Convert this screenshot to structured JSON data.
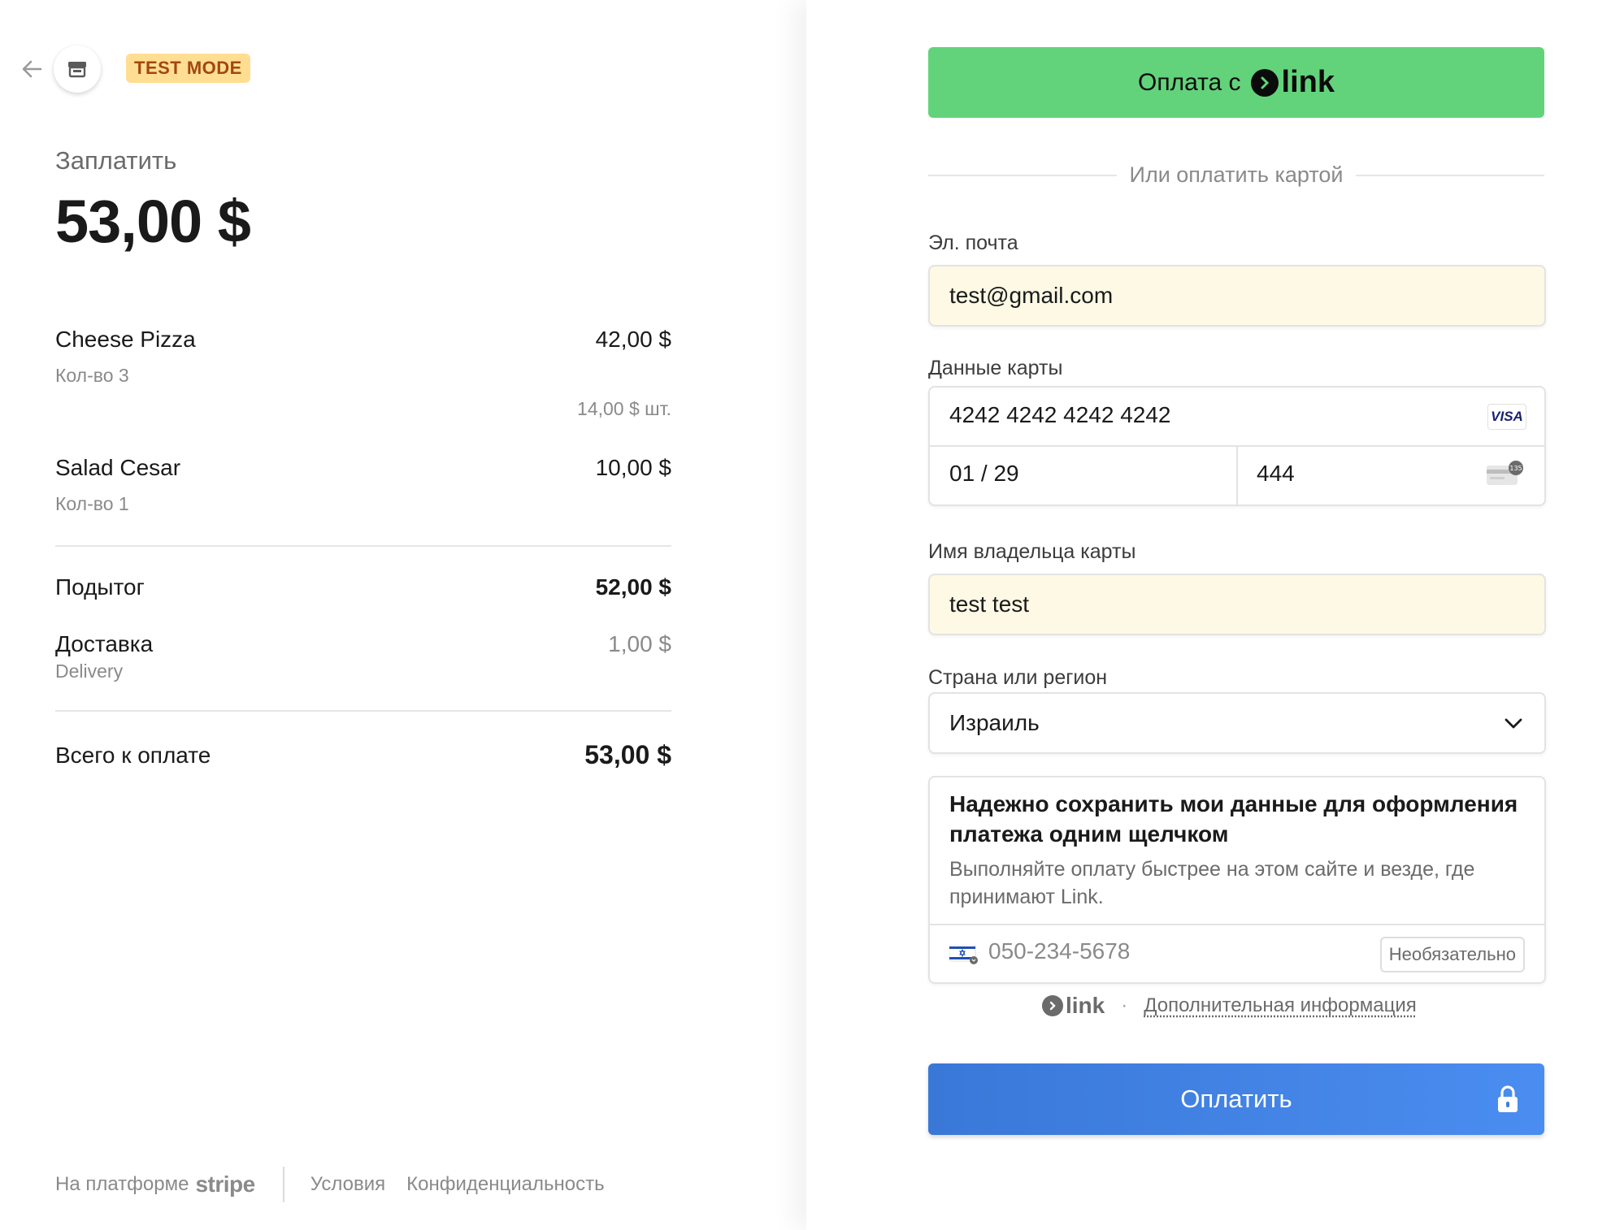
{
  "header": {
    "badge": "TEST MODE"
  },
  "summary": {
    "pay_label": "Заплатить",
    "total": "53,00 $",
    "items": [
      {
        "name": "Cheese Pizza",
        "qty": "Кол-во 3",
        "amount": "42,00 $",
        "unit_price": "14,00 $ шт."
      },
      {
        "name": "Salad Cesar",
        "qty": "Кол-во 1",
        "amount": "10,00 $"
      }
    ],
    "subtotal_label": "Подытог",
    "subtotal": "52,00 $",
    "shipping_label": "Доставка",
    "shipping_method": "Delivery",
    "shipping": "1,00 $",
    "total_label": "Всего к оплате",
    "total_due": "53,00 $"
  },
  "footer": {
    "powered_by": "На платформе",
    "brand": "stripe",
    "terms": "Условия",
    "privacy": "Конфиденциальность"
  },
  "form": {
    "link_button_label": "Оплата с",
    "link_brand": "link",
    "or_card": "Или оплатить картой",
    "email_label": "Эл. почта",
    "email_value": "test@gmail.com",
    "card_label": "Данные карты",
    "card_number": "4242 4242 4242 4242",
    "card_brand": "VISA",
    "expiry": "01 / 29",
    "cvc": "444",
    "cvc_icon_text": "135",
    "name_label": "Имя владельца карты",
    "name_value": "test test",
    "country_label": "Страна или регион",
    "country_value": "Израиль",
    "save_title": "Надежно сохранить мои данные для оформления платежа одним щелчком",
    "save_desc": "Выполняйте оплату быстрее на этом сайте и везде, где принимают Link.",
    "phone_placeholder": "050-234-5678",
    "optional": "Необязательно",
    "link_more": "Дополнительная информация",
    "pay_button": "Оплатить"
  },
  "colors": {
    "link_green": "#62d37a",
    "pay_blue": "#3a78d8",
    "test_badge_bg": "#ffde92",
    "test_badge_text": "#a2470f",
    "autofill_bg": "#fdf9e4"
  },
  "icons": [
    "back-arrow-icon",
    "store-icon",
    "link-logo-icon",
    "visa-icon",
    "cvc-card-icon",
    "chevron-down-icon",
    "israel-flag-icon",
    "lock-icon"
  ]
}
